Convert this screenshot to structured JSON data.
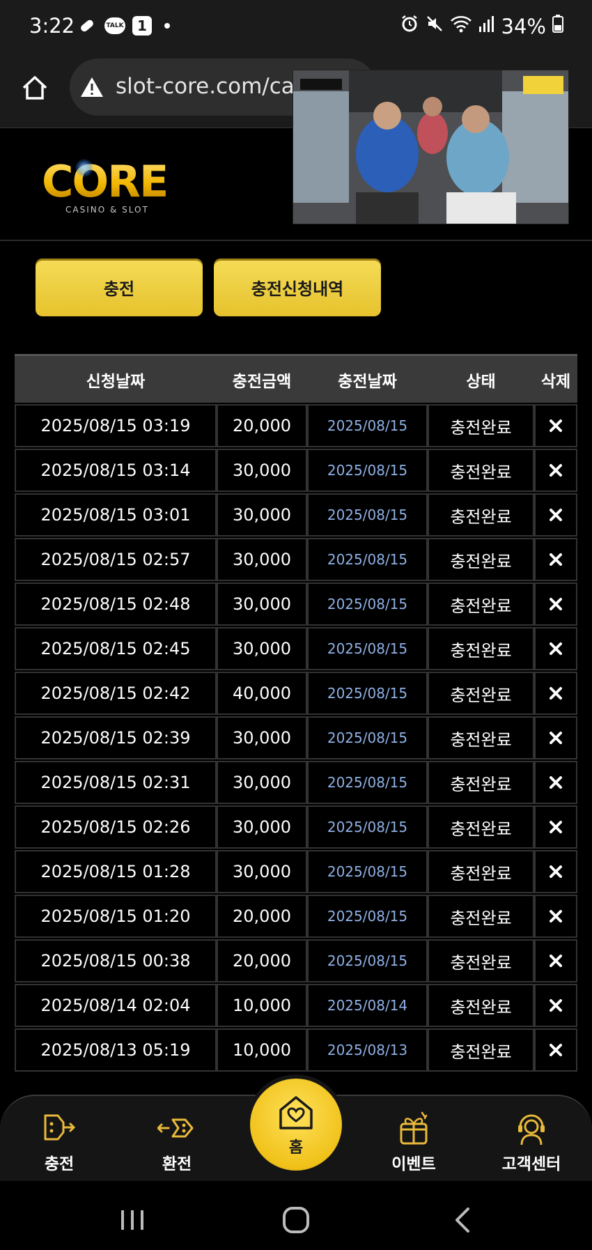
{
  "status_bar": {
    "time": "3:22",
    "talk_icon_text": "TALK",
    "notification_badge": "1",
    "battery": "34%"
  },
  "browser": {
    "url": "slot-core.com/cas"
  },
  "logo": {
    "main": "CORE",
    "sub": "CASINO & SLOT"
  },
  "tabs": {
    "charge_label": "충전",
    "history_label": "충전신청내역"
  },
  "table": {
    "headers": [
      "신청날짜",
      "충전금액",
      "충전날짜",
      "상태",
      "삭제"
    ],
    "rows": [
      {
        "requested": "2025/08/15 03:19",
        "amount": "20,000",
        "charged": "2025/08/15",
        "status": "충전완료"
      },
      {
        "requested": "2025/08/15 03:14",
        "amount": "30,000",
        "charged": "2025/08/15",
        "status": "충전완료"
      },
      {
        "requested": "2025/08/15 03:01",
        "amount": "30,000",
        "charged": "2025/08/15",
        "status": "충전완료"
      },
      {
        "requested": "2025/08/15 02:57",
        "amount": "30,000",
        "charged": "2025/08/15",
        "status": "충전완료"
      },
      {
        "requested": "2025/08/15 02:48",
        "amount": "30,000",
        "charged": "2025/08/15",
        "status": "충전완료"
      },
      {
        "requested": "2025/08/15 02:45",
        "amount": "30,000",
        "charged": "2025/08/15",
        "status": "충전완료"
      },
      {
        "requested": "2025/08/15 02:42",
        "amount": "40,000",
        "charged": "2025/08/15",
        "status": "충전완료"
      },
      {
        "requested": "2025/08/15 02:39",
        "amount": "30,000",
        "charged": "2025/08/15",
        "status": "충전완료"
      },
      {
        "requested": "2025/08/15 02:31",
        "amount": "30,000",
        "charged": "2025/08/15",
        "status": "충전완료"
      },
      {
        "requested": "2025/08/15 02:26",
        "amount": "30,000",
        "charged": "2025/08/15",
        "status": "충전완료"
      },
      {
        "requested": "2025/08/15 01:28",
        "amount": "30,000",
        "charged": "2025/08/15",
        "status": "충전완료"
      },
      {
        "requested": "2025/08/15 01:20",
        "amount": "20,000",
        "charged": "2025/08/15",
        "status": "충전완료"
      },
      {
        "requested": "2025/08/15 00:38",
        "amount": "20,000",
        "charged": "2025/08/15",
        "status": "충전완료"
      },
      {
        "requested": "2025/08/14 02:04",
        "amount": "10,000",
        "charged": "2025/08/14",
        "status": "충전완료"
      },
      {
        "requested": "2025/08/13 05:19",
        "amount": "10,000",
        "charged": "2025/08/13",
        "status": "충전완료"
      }
    ]
  },
  "bottom_nav": {
    "items": [
      {
        "label": "충전",
        "icon": "charge-icon"
      },
      {
        "label": "환전",
        "icon": "exchange-icon"
      },
      {
        "label": "홈",
        "icon": "home-heart-icon"
      },
      {
        "label": "이벤트",
        "icon": "gift-icon"
      },
      {
        "label": "고객센터",
        "icon": "support-icon"
      }
    ]
  },
  "colors": {
    "accent_yellow": "#f0c21a",
    "charged_date_blue": "#8fb1e6",
    "background": "#000000"
  }
}
